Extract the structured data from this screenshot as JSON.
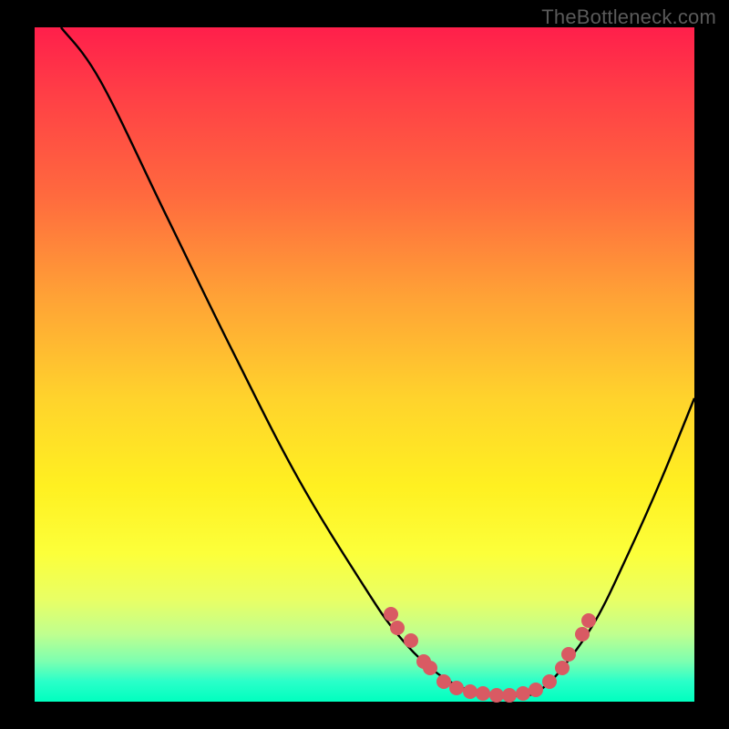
{
  "watermark": "TheBottleneck.com",
  "colors": {
    "page_bg": "#000000",
    "curve": "#000000",
    "dot": "#d95a63",
    "gradient_top": "#ff1f4b",
    "gradient_bottom": "#00ffbf"
  },
  "chart_data": {
    "type": "line",
    "title": "",
    "xlabel": "",
    "ylabel": "",
    "xlim": [
      0,
      100
    ],
    "ylim": [
      0,
      100
    ],
    "grid": false,
    "legend": false,
    "curve": {
      "points": [
        {
          "x": 4,
          "y": 100
        },
        {
          "x": 10,
          "y": 92
        },
        {
          "x": 20,
          "y": 72
        },
        {
          "x": 30,
          "y": 52
        },
        {
          "x": 40,
          "y": 33
        },
        {
          "x": 50,
          "y": 17
        },
        {
          "x": 55,
          "y": 10
        },
        {
          "x": 60,
          "y": 5
        },
        {
          "x": 65,
          "y": 2
        },
        {
          "x": 70,
          "y": 1
        },
        {
          "x": 75,
          "y": 1
        },
        {
          "x": 77,
          "y": 2
        },
        {
          "x": 80,
          "y": 5
        },
        {
          "x": 85,
          "y": 12
        },
        {
          "x": 90,
          "y": 22
        },
        {
          "x": 95,
          "y": 33
        },
        {
          "x": 100,
          "y": 45
        }
      ]
    },
    "dots": [
      {
        "x": 54,
        "y": 13
      },
      {
        "x": 55,
        "y": 11
      },
      {
        "x": 57,
        "y": 9
      },
      {
        "x": 59,
        "y": 6
      },
      {
        "x": 60,
        "y": 5
      },
      {
        "x": 62,
        "y": 3
      },
      {
        "x": 64,
        "y": 2
      },
      {
        "x": 66,
        "y": 1.5
      },
      {
        "x": 68,
        "y": 1.2
      },
      {
        "x": 70,
        "y": 1
      },
      {
        "x": 72,
        "y": 1
      },
      {
        "x": 74,
        "y": 1.2
      },
      {
        "x": 76,
        "y": 1.8
      },
      {
        "x": 78,
        "y": 3
      },
      {
        "x": 80,
        "y": 5
      },
      {
        "x": 81,
        "y": 7
      },
      {
        "x": 83,
        "y": 10
      },
      {
        "x": 84,
        "y": 12
      }
    ]
  }
}
